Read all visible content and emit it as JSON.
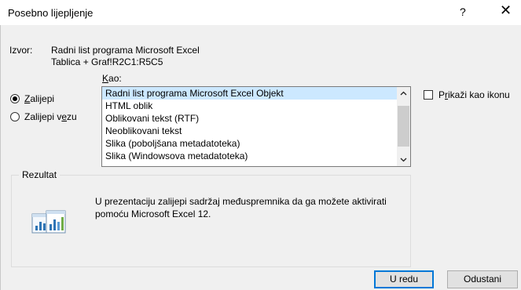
{
  "dialog": {
    "title": "Posebno lijepljenje",
    "help_label": "?",
    "close_label": "✕"
  },
  "source": {
    "label": "Izvor:",
    "line1": "Radni list programa Microsoft Excel",
    "line2": "Tablica + Graf!R2C1:R5C5"
  },
  "as_label": {
    "accel": "K",
    "rest": "ao:"
  },
  "options": {
    "paste": {
      "accel": "Z",
      "rest": "alijepi",
      "checked": true
    },
    "paste_link": {
      "pre": "Zalijepi v",
      "accel": "e",
      "post": "zu",
      "checked": false
    }
  },
  "list": {
    "items": [
      "Radni list programa Microsoft Excel Objekt",
      "HTML oblik",
      "Oblikovani tekst (RTF)",
      "Neoblikovani tekst",
      "Slika (poboljšana metadatoteka)",
      "Slika (Windowsova metadatoteka)"
    ],
    "selected_index": 0
  },
  "display_as_icon": {
    "pre": "P",
    "accel": "r",
    "post": "ikaži kao ikonu",
    "checked": false
  },
  "result": {
    "title": "Rezultat",
    "text": "U prezentaciju zalijepi sadržaj međuspremnika da ga možete aktivirati pomoću Microsoft Excel 12."
  },
  "buttons": {
    "ok": "U redu",
    "cancel": "Odustani"
  },
  "icons": {
    "scroll_up": "chevron-up-icon",
    "scroll_down": "chevron-down-icon",
    "result": "excel-chart-icon"
  }
}
